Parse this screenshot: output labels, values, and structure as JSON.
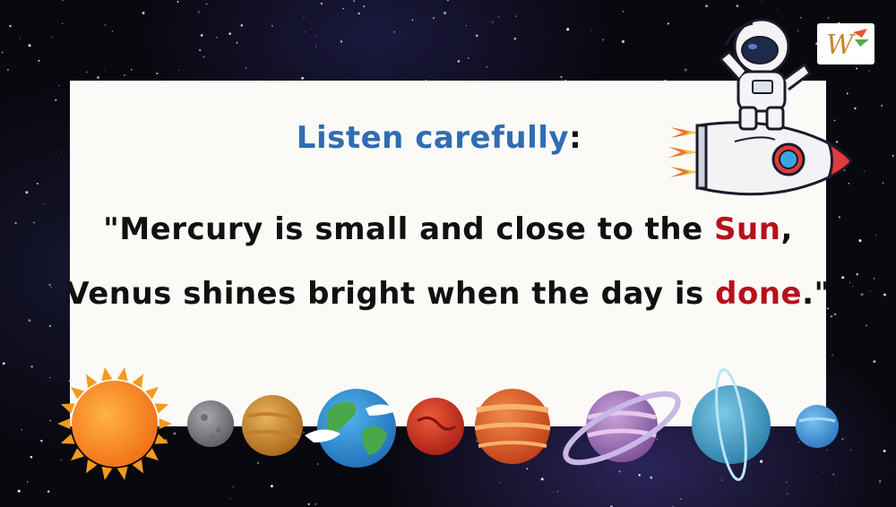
{
  "title": {
    "text": "Listen carefully",
    "colon": ":"
  },
  "verse": {
    "line1_prefix": "\"Mercury is small and close to the ",
    "line1_highlight": "Sun",
    "line1_suffix": ",",
    "line2_prefix": "Venus shines bright when the day is ",
    "line2_highlight": "done",
    "line2_suffix": ".\""
  },
  "logo": {
    "letter": "W"
  },
  "colors": {
    "title": "#2f6db3",
    "highlight": "#b5121b",
    "card": "#fbfaf7",
    "space": "#08080f"
  },
  "planets": [
    "sun-icon",
    "mercury-icon",
    "venus-icon",
    "earth-icon",
    "mars-icon",
    "jupiter-icon",
    "saturn-icon",
    "uranus-icon",
    "neptune-icon"
  ]
}
